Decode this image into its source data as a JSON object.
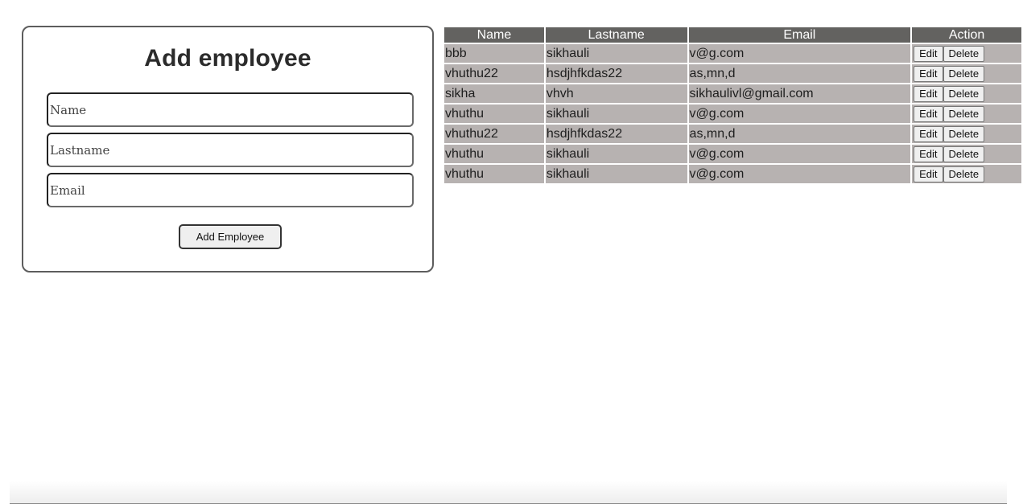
{
  "form": {
    "title": "Add employee",
    "name_placeholder": "Name",
    "lastname_placeholder": "Lastname",
    "email_placeholder": "Email",
    "submit_label": "Add Employee"
  },
  "table": {
    "headers": {
      "name": "Name",
      "lastname": "Lastname",
      "email": "Email",
      "action": "Action"
    },
    "edit_label": "Edit",
    "delete_label": "Delete",
    "rows": [
      {
        "name": "bbb",
        "lastname": "sikhauli",
        "email": "v@g.com"
      },
      {
        "name": "vhuthu22",
        "lastname": "hsdjhfkdas22",
        "email": "as,mn,d"
      },
      {
        "name": "sikha",
        "lastname": "vhvh",
        "email": "sikhaulivl@gmail.com"
      },
      {
        "name": "vhuthu",
        "lastname": "sikhauli",
        "email": "v@g.com"
      },
      {
        "name": "vhuthu22",
        "lastname": "hsdjhfkdas22",
        "email": "as,mn,d"
      },
      {
        "name": "vhuthu",
        "lastname": "sikhauli",
        "email": "v@g.com"
      },
      {
        "name": "vhuthu",
        "lastname": "sikhauli",
        "email": "v@g.com"
      }
    ]
  },
  "colors": {
    "header_bg": "#636260",
    "cell_bg": "#b7b2b1",
    "card_border": "#5d5d5d"
  }
}
